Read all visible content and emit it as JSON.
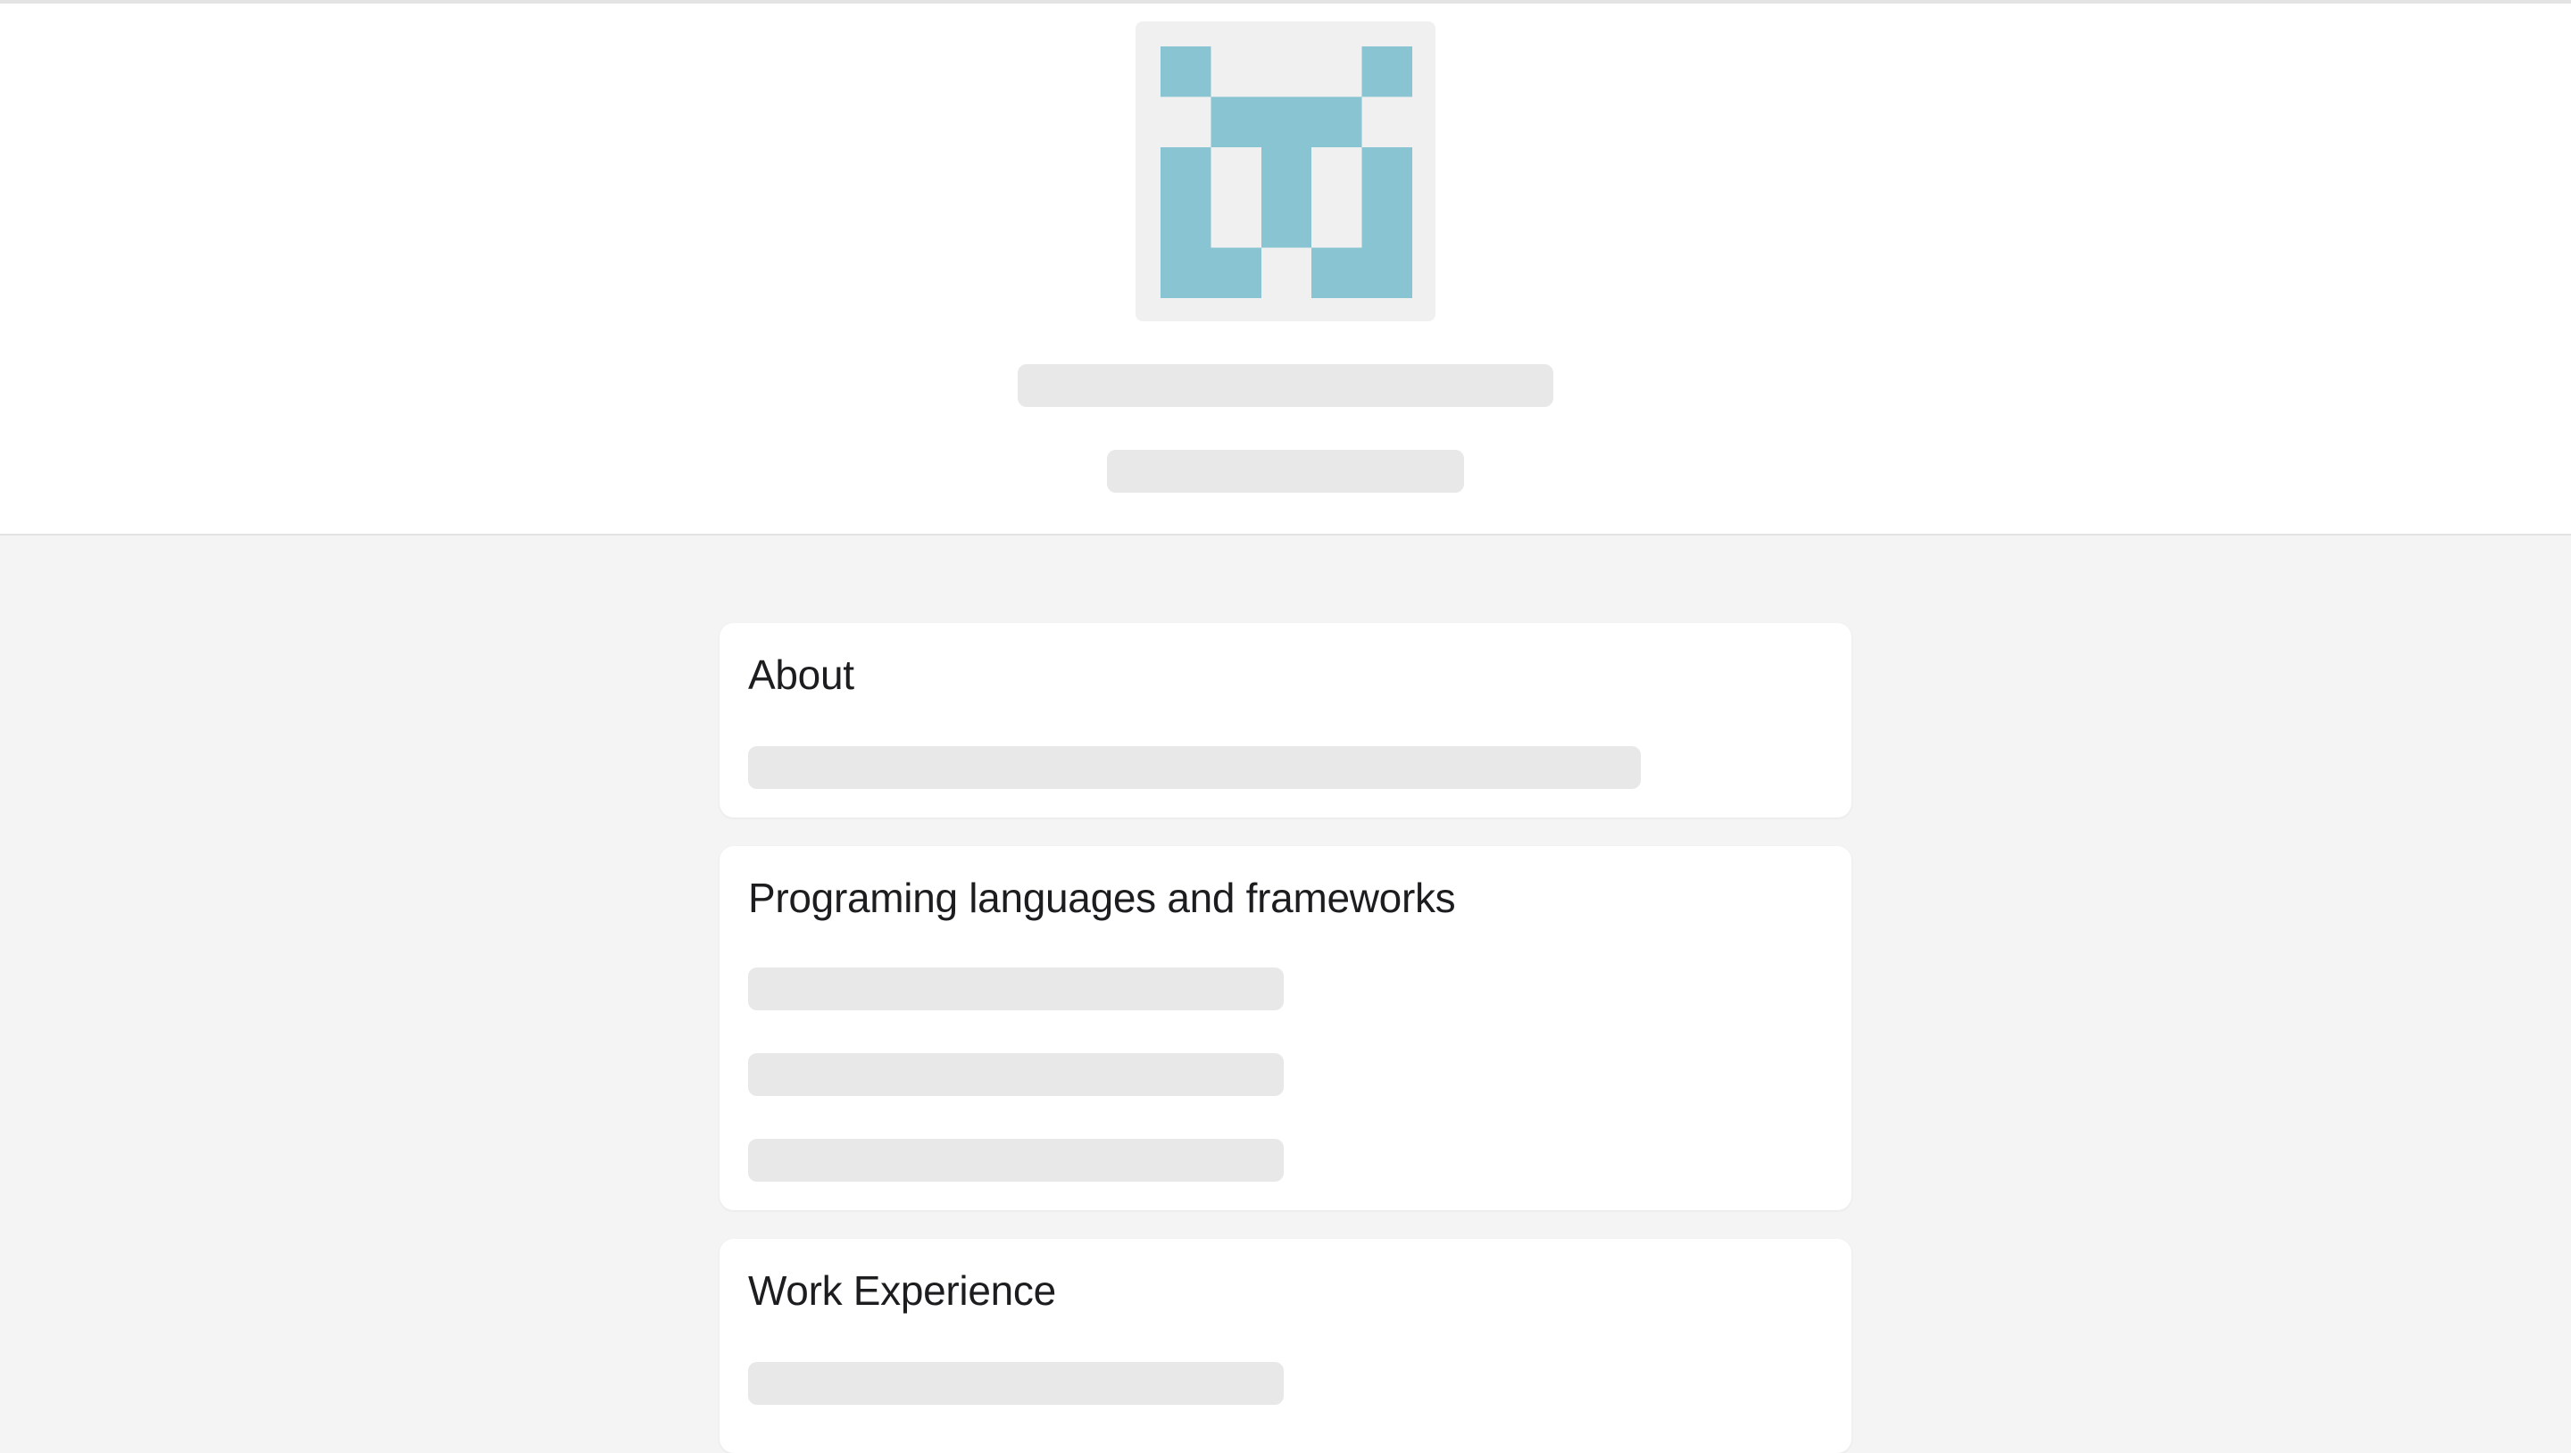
{
  "colors": {
    "page_background": "#f4f4f4",
    "header_background": "#ffffff",
    "avatar_tile": "#88c4d1",
    "avatar_background": "#f0f0f0",
    "skeleton": "#e8e8e8",
    "card_background": "#ffffff"
  },
  "profile": {
    "avatar_icon": "identicon-avatar",
    "name_loading": true,
    "subtitle_loading": true
  },
  "sections": [
    {
      "title": "About",
      "placeholder_lines": 1
    },
    {
      "title": "Programing languages and frameworks",
      "placeholder_lines": 3
    },
    {
      "title": "Work Experience",
      "placeholder_lines": 1
    }
  ]
}
